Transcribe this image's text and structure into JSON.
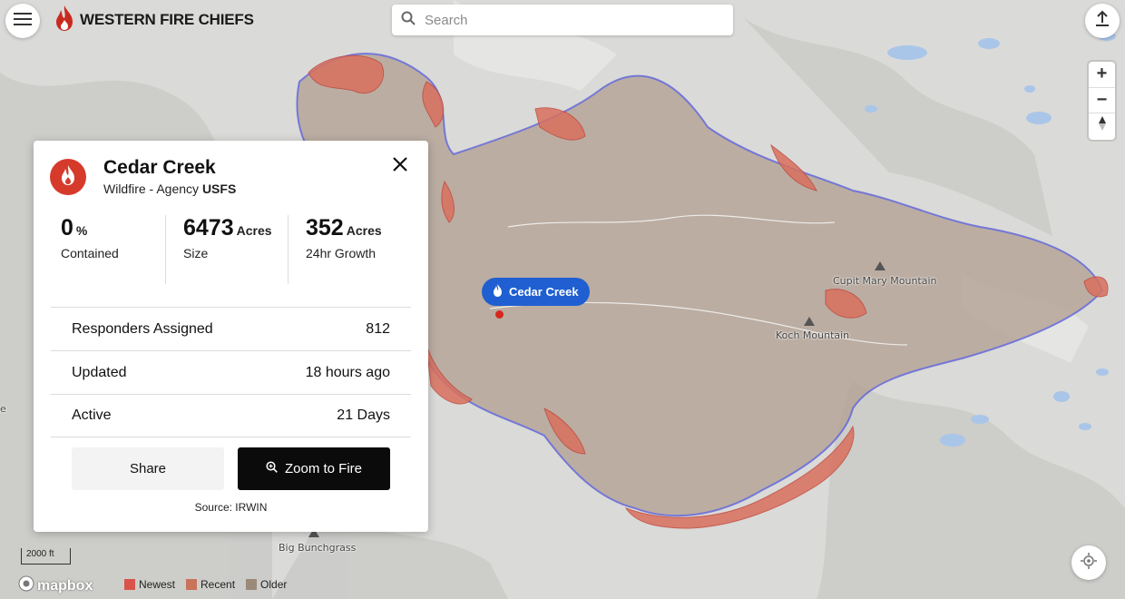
{
  "app": {
    "brand": "WESTERN FIRE CHIEFS"
  },
  "search": {
    "placeholder": "Search"
  },
  "map_controls": {
    "zoom_in": "+",
    "zoom_out": "−"
  },
  "fire": {
    "name": "Cedar Creek",
    "type": "Wildfire",
    "agency_prefix": "Agency",
    "agency": "USFS",
    "stats": [
      {
        "value": "0",
        "unit": "%",
        "label": "Contained"
      },
      {
        "value": "6473",
        "unit": "Acres",
        "label": "Size"
      },
      {
        "value": "352",
        "unit": "Acres",
        "label": "24hr Growth"
      }
    ],
    "rows": [
      {
        "label": "Responders Assigned",
        "value": "812"
      },
      {
        "label": "Updated",
        "value": "18 hours ago"
      },
      {
        "label": "Active",
        "value": "21 Days"
      }
    ],
    "share_label": "Share",
    "zoom_label": "Zoom to Fire",
    "source": "Source: IRWIN"
  },
  "map": {
    "marker_label": "Cedar Creek",
    "places": [
      "Cupit Mary Mountain",
      "Koch Mountain",
      "Big Bunchgrass"
    ],
    "scale": "2000 ft",
    "attribution": "mapbox",
    "edge_label": "e"
  },
  "legend": [
    {
      "label": "Newest",
      "color": "#d9534a"
    },
    {
      "label": "Recent",
      "color": "#c8735a"
    },
    {
      "label": "Older",
      "color": "#9b8a7a"
    }
  ],
  "colors": {
    "perimeter": "#5b5fd6",
    "fire_fill": "#b09a8c",
    "accent": "#d63a2b",
    "marker": "#1f5fd1"
  }
}
